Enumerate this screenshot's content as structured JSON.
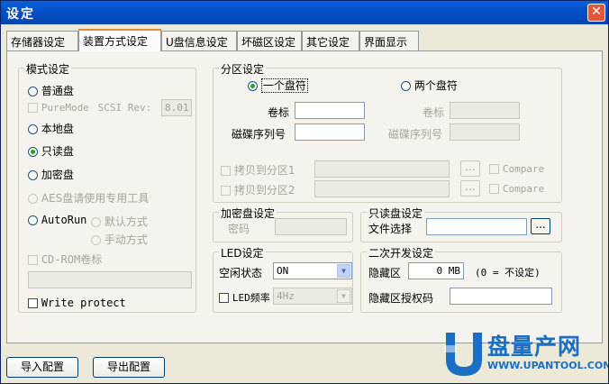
{
  "window": {
    "title": "设定",
    "close_label": "✕"
  },
  "tabs": [
    {
      "label": "存储器设定"
    },
    {
      "label": "装置方式设定"
    },
    {
      "label": "U盘信息设定"
    },
    {
      "label": "坏磁区设定"
    },
    {
      "label": "其它设定"
    },
    {
      "label": "界面显示"
    }
  ],
  "mode": {
    "legend": "模式设定",
    "normal": "普通盘",
    "puremode": "PureMode",
    "scsi_rev_label": "SCSI Rev:",
    "scsi_rev_value": "8.01",
    "local": "本地盘",
    "readonly": "只读盘",
    "encrypt": "加密盘",
    "aes": "AES盘请使用专用工具",
    "autorun": "AutoRun",
    "default_mode": "默认方式",
    "manual_mode": "手动方式",
    "cdrom_label": "CD-ROM卷标",
    "cdrom_value": "",
    "write_protect": "Write protect"
  },
  "partition": {
    "legend": "分区设定",
    "one_drive": "一个盘符",
    "two_drives": "两个盘符",
    "volume_label": "卷标",
    "serial_label": "磁碟序列号",
    "volume_label_2": "卷标",
    "serial_label_2": "磁碟序列号",
    "copy1": "拷贝到分区1",
    "copy2": "拷贝到分区2",
    "browse": "...",
    "compare": "Compare"
  },
  "encrypt_disk": {
    "legend": "加密盘设定",
    "password_label": "密码"
  },
  "readonly_disk": {
    "legend": "只读盘设定",
    "file_label": "文件选择",
    "browse": "..."
  },
  "led": {
    "legend": "LED设定",
    "idle_label": "空闲状态",
    "idle_value": "ON",
    "freq_label": "LED频率",
    "freq_value": "4Hz"
  },
  "dev": {
    "legend": "二次开发设定",
    "hidden_label": "隐藏区",
    "hidden_value": "0",
    "hidden_unit": "MB",
    "hidden_note": "(0 = 不设定)",
    "auth_label": "隐藏区授权码"
  },
  "footer": {
    "import": "导入配置",
    "export": "导出配置"
  },
  "watermark": {
    "brand": "盘量产网",
    "url": "WWW.UPANTOOL.COM"
  },
  "colors": {
    "titlebar": "#0351c8",
    "accent_tab": "#e68b2c",
    "watermark_blue": "#1a6fc4"
  }
}
